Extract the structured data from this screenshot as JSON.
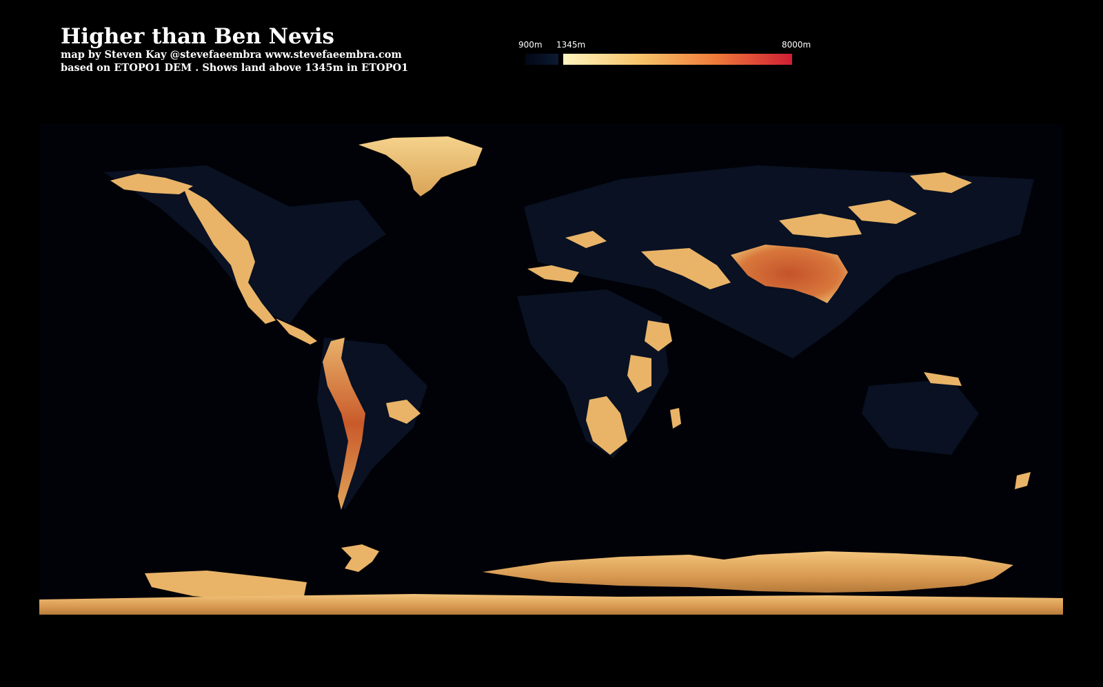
{
  "header": {
    "title": "Higher than Ben Nevis",
    "credit": "map by Steven Kay @stevefaeembra www.stevefaeembra.com",
    "source": "based on ETOPO1 DEM . Shows land above 1345m in ETOPO1"
  },
  "legend": {
    "low_label": "900m",
    "threshold_label": "1345m",
    "high_label": "8000m",
    "low_colors": [
      "#020814",
      "#0c1a33"
    ],
    "high_colors": [
      "#fff3c0",
      "#f7c46a",
      "#ef7a3a",
      "#d01e34"
    ]
  },
  "colors": {
    "background": "#000000",
    "ocean": "#010207",
    "lowland": "#0a1428",
    "highland": "#e9b468",
    "plateau": "#c95a2a",
    "antarctic": "#e3ad5e"
  }
}
